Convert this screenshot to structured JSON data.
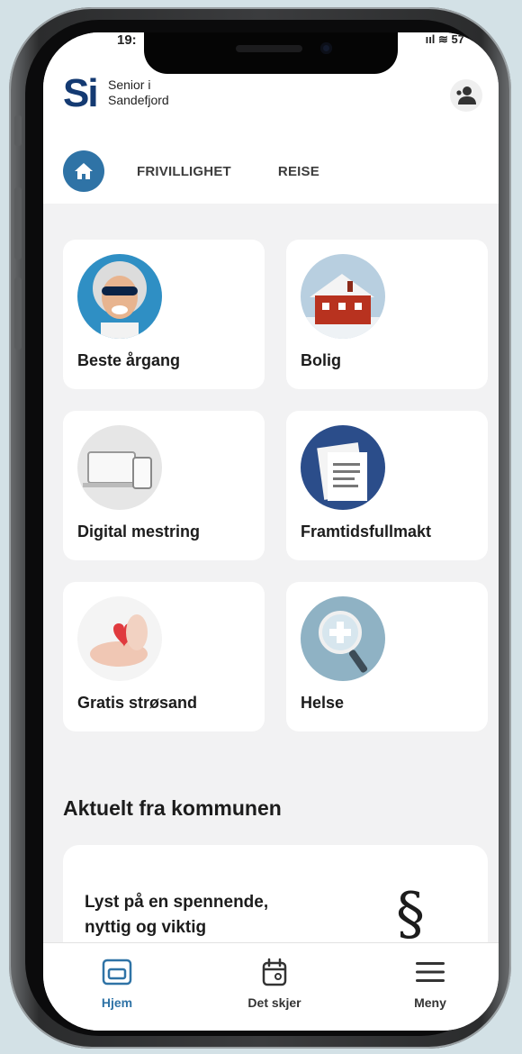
{
  "status_bar": {
    "time": "19:",
    "right": "ııl ≋ 57"
  },
  "brand": {
    "logo_letters": "Si",
    "line1": "Senior i",
    "line2": "Sandefjord"
  },
  "profile": {
    "icon": "user-profile-icon"
  },
  "tabs": [
    {
      "label": "FRIVILLIGHET"
    },
    {
      "label": "REISE"
    }
  ],
  "home_tab": {
    "icon": "home-icon",
    "color": "#2f73a6"
  },
  "cards": [
    {
      "label": "Beste årgang",
      "icon": "senior-woman-photo"
    },
    {
      "label": "Bolig",
      "icon": "red-house-photo"
    },
    {
      "label": "Digital mestring",
      "icon": "devices-photo"
    },
    {
      "label": "Framtidsfullmakt",
      "icon": "documents-photo"
    },
    {
      "label": "Gratis strøsand",
      "icon": "heart-in-hands-photo"
    },
    {
      "label": "Helse",
      "icon": "magnifier-cross-photo"
    }
  ],
  "section": {
    "title": "Aktuelt fra kommunen"
  },
  "news": {
    "line1": "Lyst på en spennende,",
    "line2": "nyttig og viktig",
    "symbol": "§"
  },
  "bottom_nav": [
    {
      "label": "Hjem",
      "icon": "home-card-icon"
    },
    {
      "label": "Det skjer",
      "icon": "calendar-icon"
    },
    {
      "label": "Meny",
      "icon": "hamburger-menu-icon"
    }
  ],
  "colors": {
    "accent": "#2f73a6",
    "brand": "#143a72",
    "background": "#f2f2f3"
  }
}
